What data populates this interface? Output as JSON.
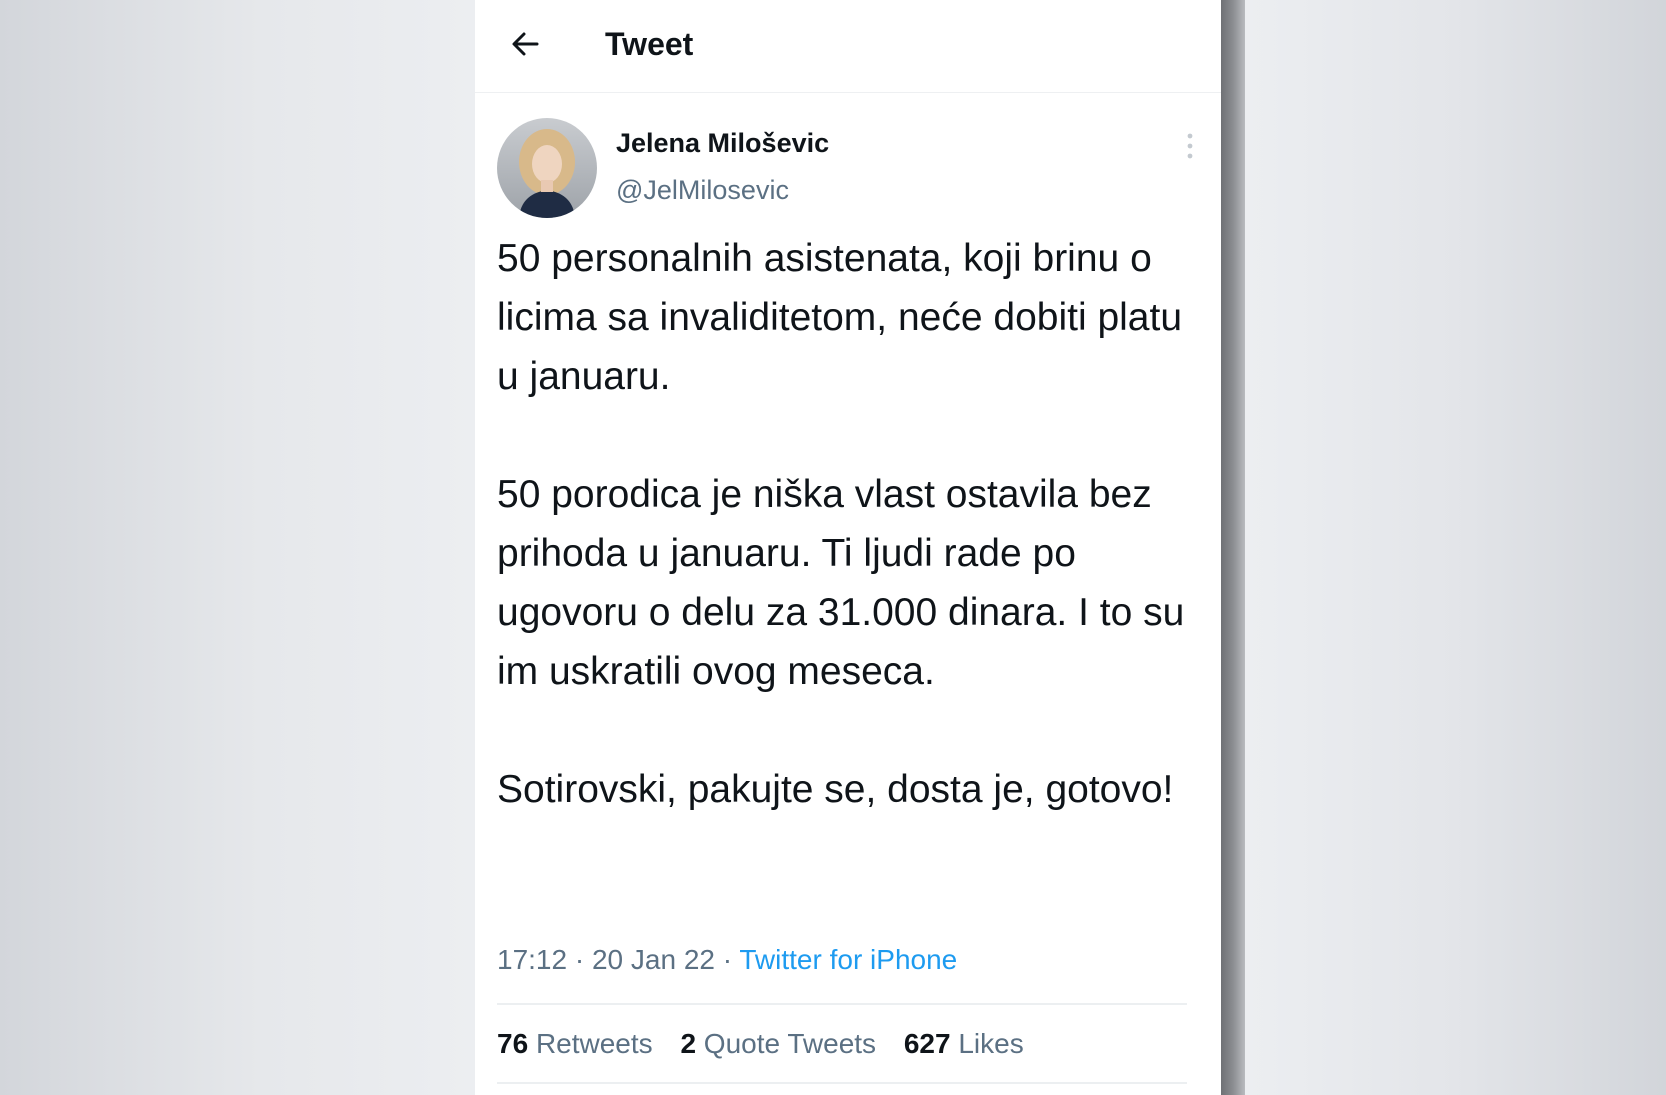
{
  "header": {
    "back_icon": "arrow-left-icon",
    "title": "Tweet"
  },
  "tweet": {
    "author": {
      "name": "Jelena Miloševic",
      "handle": "@JelMilosevic"
    },
    "more_icon": "vertical-ellipsis-icon",
    "paragraphs": [
      "50 personalnih asistenata, koji brinu o licima sa invaliditetom, neće dobiti platu u januaru.",
      "50 porodica je niška vlast ostavila bez prihoda u januaru. Ti ljudi rade po ugovoru o delu za 31.000 dinara. I to su im uskratili ovog meseca.",
      "Sotirovski, pakujte se, dosta je, gotovo!"
    ],
    "time": "17:12",
    "separator": " · ",
    "date": "20 Jan 22",
    "source": "Twitter for iPhone",
    "stats": {
      "retweets_count": "76",
      "retweets_label": "Retweets",
      "quotes_count": "2",
      "quotes_label": "Quote Tweets",
      "likes_count": "627",
      "likes_label": "Likes"
    }
  },
  "colors": {
    "link": "#1d9bf0",
    "text": "#0f1419",
    "secondary": "#5b7083"
  }
}
